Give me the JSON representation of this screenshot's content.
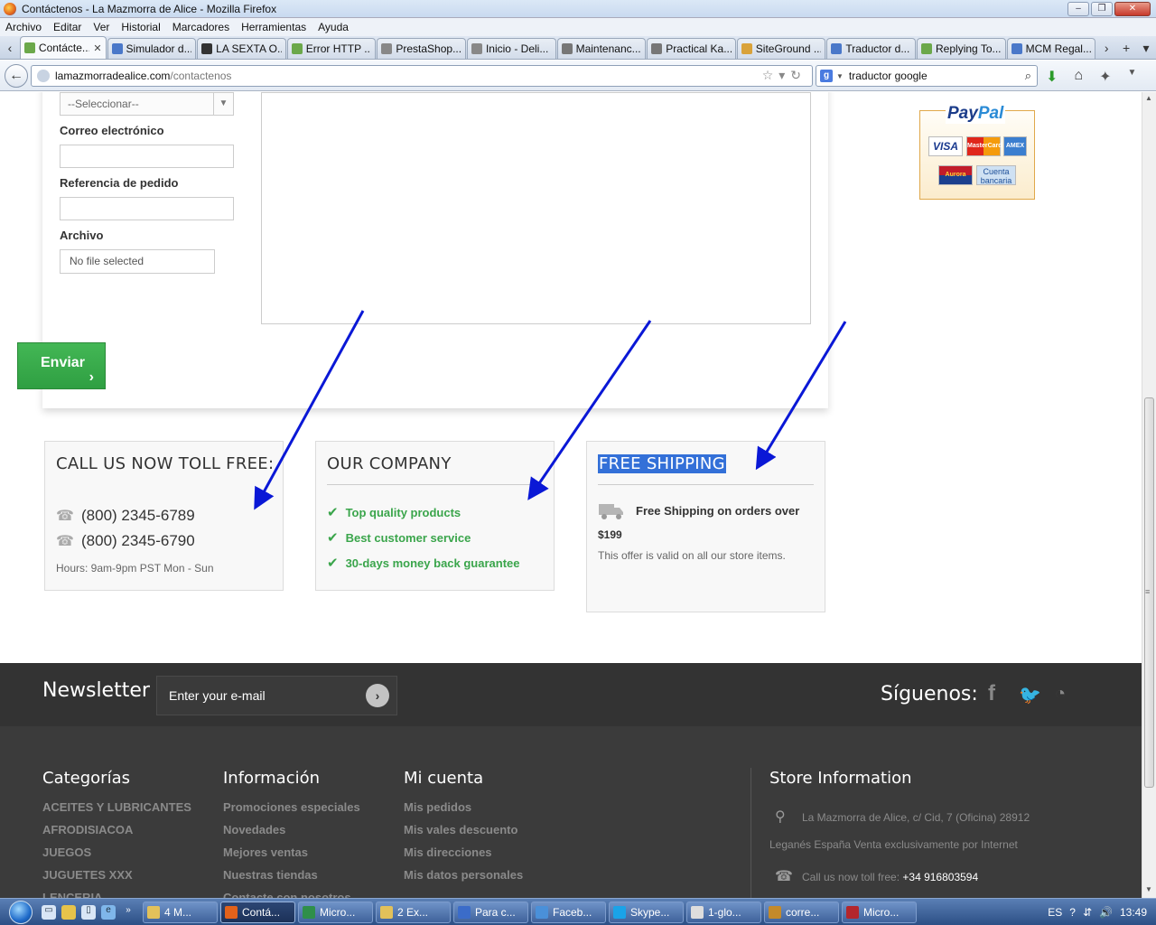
{
  "window": {
    "title": "Contáctenos - La Mazmorra de Alice - Mozilla Firefox",
    "min": "–",
    "max": "❐",
    "close": "✕"
  },
  "menu": [
    "Archivo",
    "Editar",
    "Ver",
    "Historial",
    "Marcadores",
    "Herramientas",
    "Ayuda"
  ],
  "tabs": [
    {
      "label": "Contácte...",
      "color": "#6ba84a"
    },
    {
      "label": "Simulador d...",
      "color": "#4a78c9"
    },
    {
      "label": "LA SEXTA O...",
      "color": "#333333"
    },
    {
      "label": "Error HTTP ...",
      "color": "#6ba84a"
    },
    {
      "label": "PrestaShop...",
      "color": "#888888"
    },
    {
      "label": "Inicio - Deli...",
      "color": "#888888"
    },
    {
      "label": "Maintenanc...",
      "color": "#777777"
    },
    {
      "label": "Practical Ka...",
      "color": "#777777"
    },
    {
      "label": "SiteGround ...",
      "color": "#d9a23a"
    },
    {
      "label": "Traductor d...",
      "color": "#4a78c9"
    },
    {
      "label": "Replying To...",
      "color": "#6ba84a"
    },
    {
      "label": "MCM Regal...",
      "color": "#4a78c9"
    }
  ],
  "tab_nav": {
    "left": "‹",
    "right": "›",
    "new": "+",
    "list": "▾"
  },
  "address": {
    "host": "lamazmorradealice.com",
    "path": "/contactenos"
  },
  "search": {
    "engine": "g",
    "query": "traductor google"
  },
  "form": {
    "select_value": "--Seleccionar--",
    "email_label": "Correo electrónico",
    "order_label": "Referencia de pedido",
    "file_label": "Archivo",
    "file_value": "No file selected",
    "send_label": "Enviar"
  },
  "paypal": {
    "logo_a": "Pay",
    "logo_b": "Pal",
    "cards": [
      "VISA",
      "MasterCard",
      "AMEX",
      "Aurora",
      "Cuenta bancaria"
    ]
  },
  "call_box": {
    "title": "CALL US NOW TOLL FREE:",
    "phones": [
      "(800) 2345-6789",
      "(800) 2345-6790"
    ],
    "hours": "Hours: 9am-9pm PST Mon - Sun"
  },
  "company_box": {
    "title": "OUR COMPANY",
    "items": [
      "Top quality products",
      "Best customer service",
      "30-days money back guarantee"
    ]
  },
  "shipping_box": {
    "title": "FREE SHIPPING",
    "line1": "Free Shipping on orders over",
    "line2": "$199",
    "line3": "This offer is valid on all our store items."
  },
  "newsletter": {
    "title": "Newsletter",
    "placeholder": "Enter your e-mail",
    "follow": "Síguenos:"
  },
  "footer": {
    "categorias": {
      "title": "Categorías",
      "items": [
        "ACEITES Y LUBRICANTES",
        "AFRODISIACOA",
        "JUEGOS",
        "JUGUETES XXX",
        "LENCERIA"
      ]
    },
    "informacion": {
      "title": "Información",
      "items": [
        "Promociones especiales",
        "Novedades",
        "Mejores ventas",
        "Nuestras tiendas",
        "Contacte con nosotros"
      ]
    },
    "cuenta": {
      "title": "Mi cuenta",
      "items": [
        "Mis pedidos",
        "Mis vales descuento",
        "Mis direcciones",
        "Mis datos personales"
      ]
    },
    "store": {
      "title": "Store Information",
      "address1": "La Mazmorra de Alice, c/ Cid, 7 (Oficina) 28912",
      "address2": "Leganés España Venta exclusivamente por Internet",
      "call_label": "Call us now toll free:",
      "call_number": "+34 916803594"
    }
  },
  "taskbar": {
    "items": [
      {
        "label": "4 M...",
        "color": "#e2c15a"
      },
      {
        "label": "Contá...",
        "color": "#e2621b",
        "active": true
      },
      {
        "label": "Micro...",
        "color": "#2f8f4a"
      },
      {
        "label": "2 Ex...",
        "color": "#e2c15a"
      },
      {
        "label": "Para c...",
        "color": "#3b6cc9"
      },
      {
        "label": "Faceb...",
        "color": "#4a90d9"
      },
      {
        "label": "Skype...",
        "color": "#1aa3e8"
      },
      {
        "label": "1-glo...",
        "color": "#dddddd"
      },
      {
        "label": "corre...",
        "color": "#c48a2a"
      },
      {
        "label": "Micro...",
        "color": "#b3262c"
      }
    ],
    "lang": "ES",
    "clock": "13:49"
  }
}
